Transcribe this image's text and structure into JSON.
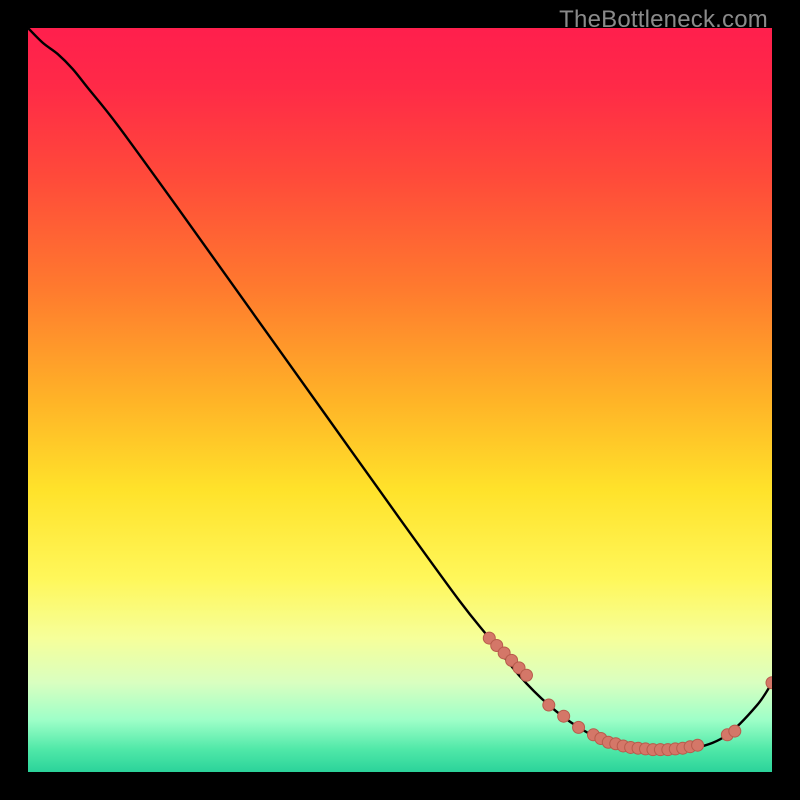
{
  "watermark": "TheBottleneck.com",
  "colors": {
    "curve": "#000000",
    "marker_fill": "#d47768",
    "marker_stroke": "#b85b4c",
    "black": "#000000"
  },
  "chart_data": {
    "type": "line",
    "title": "",
    "xlabel": "",
    "ylabel": "",
    "xlim": [
      0,
      100
    ],
    "ylim": [
      0,
      100
    ],
    "gradient_stops": [
      {
        "offset": 0.0,
        "color": "#ff1f4d"
      },
      {
        "offset": 0.08,
        "color": "#ff2a47"
      },
      {
        "offset": 0.2,
        "color": "#ff4a3a"
      },
      {
        "offset": 0.35,
        "color": "#ff7a2e"
      },
      {
        "offset": 0.5,
        "color": "#ffb327"
      },
      {
        "offset": 0.62,
        "color": "#ffe22a"
      },
      {
        "offset": 0.74,
        "color": "#fff75a"
      },
      {
        "offset": 0.82,
        "color": "#f6ff9a"
      },
      {
        "offset": 0.88,
        "color": "#d9ffc0"
      },
      {
        "offset": 0.93,
        "color": "#9effc8"
      },
      {
        "offset": 0.97,
        "color": "#4fe8a8"
      },
      {
        "offset": 1.0,
        "color": "#2bd39a"
      }
    ],
    "series": [
      {
        "name": "bottleneck-curve",
        "x": [
          0,
          2,
          4,
          6,
          8,
          12,
          20,
          30,
          40,
          50,
          58,
          62,
          66,
          70,
          74,
          78,
          82,
          86,
          90,
          94,
          98,
          100
        ],
        "y": [
          100,
          98,
          96.5,
          94.5,
          92,
          87,
          76,
          62,
          48,
          34,
          23,
          18,
          13,
          9,
          6,
          4,
          3.2,
          3,
          3.3,
          5,
          9,
          12
        ]
      }
    ],
    "markers": {
      "name": "highlight-dots",
      "x": [
        62,
        63,
        64,
        65,
        66,
        67,
        70,
        72,
        74,
        76,
        77,
        78,
        79,
        80,
        81,
        82,
        83,
        84,
        85,
        86,
        87,
        88,
        89,
        90,
        94,
        95,
        100
      ],
      "y": [
        18,
        17,
        16,
        15,
        14,
        13,
        9,
        7.5,
        6,
        5,
        4.5,
        4,
        3.8,
        3.5,
        3.3,
        3.2,
        3.1,
        3,
        3,
        3,
        3.1,
        3.2,
        3.4,
        3.6,
        5,
        5.5,
        12
      ],
      "r": 6
    }
  }
}
